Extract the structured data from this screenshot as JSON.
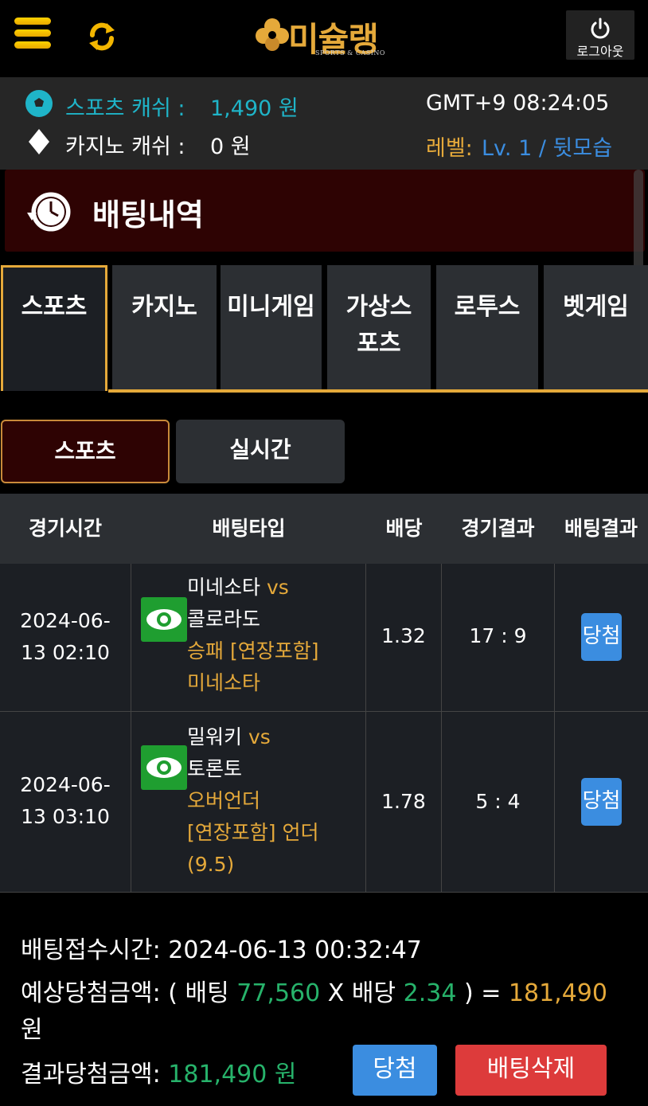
{
  "header": {
    "logo_text": "미슐랭",
    "logo_sub": "SPORTS & CASINO",
    "logout_label": "로그아웃",
    "icons": {
      "menu": "hamburger-icon",
      "refresh": "refresh-icon",
      "logout": "power-icon"
    },
    "accent_color": "#e5a93a"
  },
  "info": {
    "sports_cash_label": "스포츠 캐쉬 :",
    "sports_cash_value": "1,490 원",
    "casino_cash_label": "카지노 캐쉬 :",
    "casino_cash_value": "0 원",
    "clock": "GMT+9 08:24:05",
    "level_label": "레벨:",
    "level_value": "Lv. 1 / 뒷모습"
  },
  "page_title": "배팅내역",
  "tabs": [
    {
      "label": "스포츠",
      "active": true
    },
    {
      "label": "카지노",
      "active": false
    },
    {
      "label": "미니게임",
      "active": false
    },
    {
      "label": "가상스포츠",
      "active": false
    },
    {
      "label": "로투스",
      "active": false
    },
    {
      "label": "벳게임",
      "active": false
    }
  ],
  "subtabs": {
    "sports": "스포츠",
    "live": "실시간"
  },
  "table": {
    "headers": [
      "경기시간",
      "배팅타입",
      "배당",
      "경기결과",
      "배팅결과"
    ],
    "rows": [
      {
        "date": "2024-06-",
        "time": "13 02:10",
        "home": "미네소타",
        "vs": "vs",
        "away": "콜로라도",
        "bet_type": "승패 [연장포함]",
        "pick": "미네소타",
        "odds": "1.32",
        "score": "17 : 9",
        "result": "당첨"
      },
      {
        "date": "2024-06-",
        "time": "13 03:10",
        "home": "밀워키",
        "vs": "vs",
        "away": "토론토",
        "bet_type": "오버언더",
        "bet_type2": "[연장포함]",
        "pick": "언더",
        "line": "(9.5)",
        "odds": "1.78",
        "score": "5 : 4",
        "result": "당첨"
      }
    ]
  },
  "summary": {
    "received_label": "배팅접수시간:",
    "received_value": "2024-06-13 00:32:47",
    "expected_label": "예상당첨금액: ( 배팅",
    "bet_amount": "77,560",
    "x_odds_label": "X 배당",
    "total_odds": "2.34",
    "eq": ") =",
    "expected_value": "181,490",
    "won_unit": "원",
    "result_label": "결과당첨금액:",
    "result_value": "181,490 원",
    "win_button": "당첨",
    "delete_button": "배팅삭제"
  }
}
